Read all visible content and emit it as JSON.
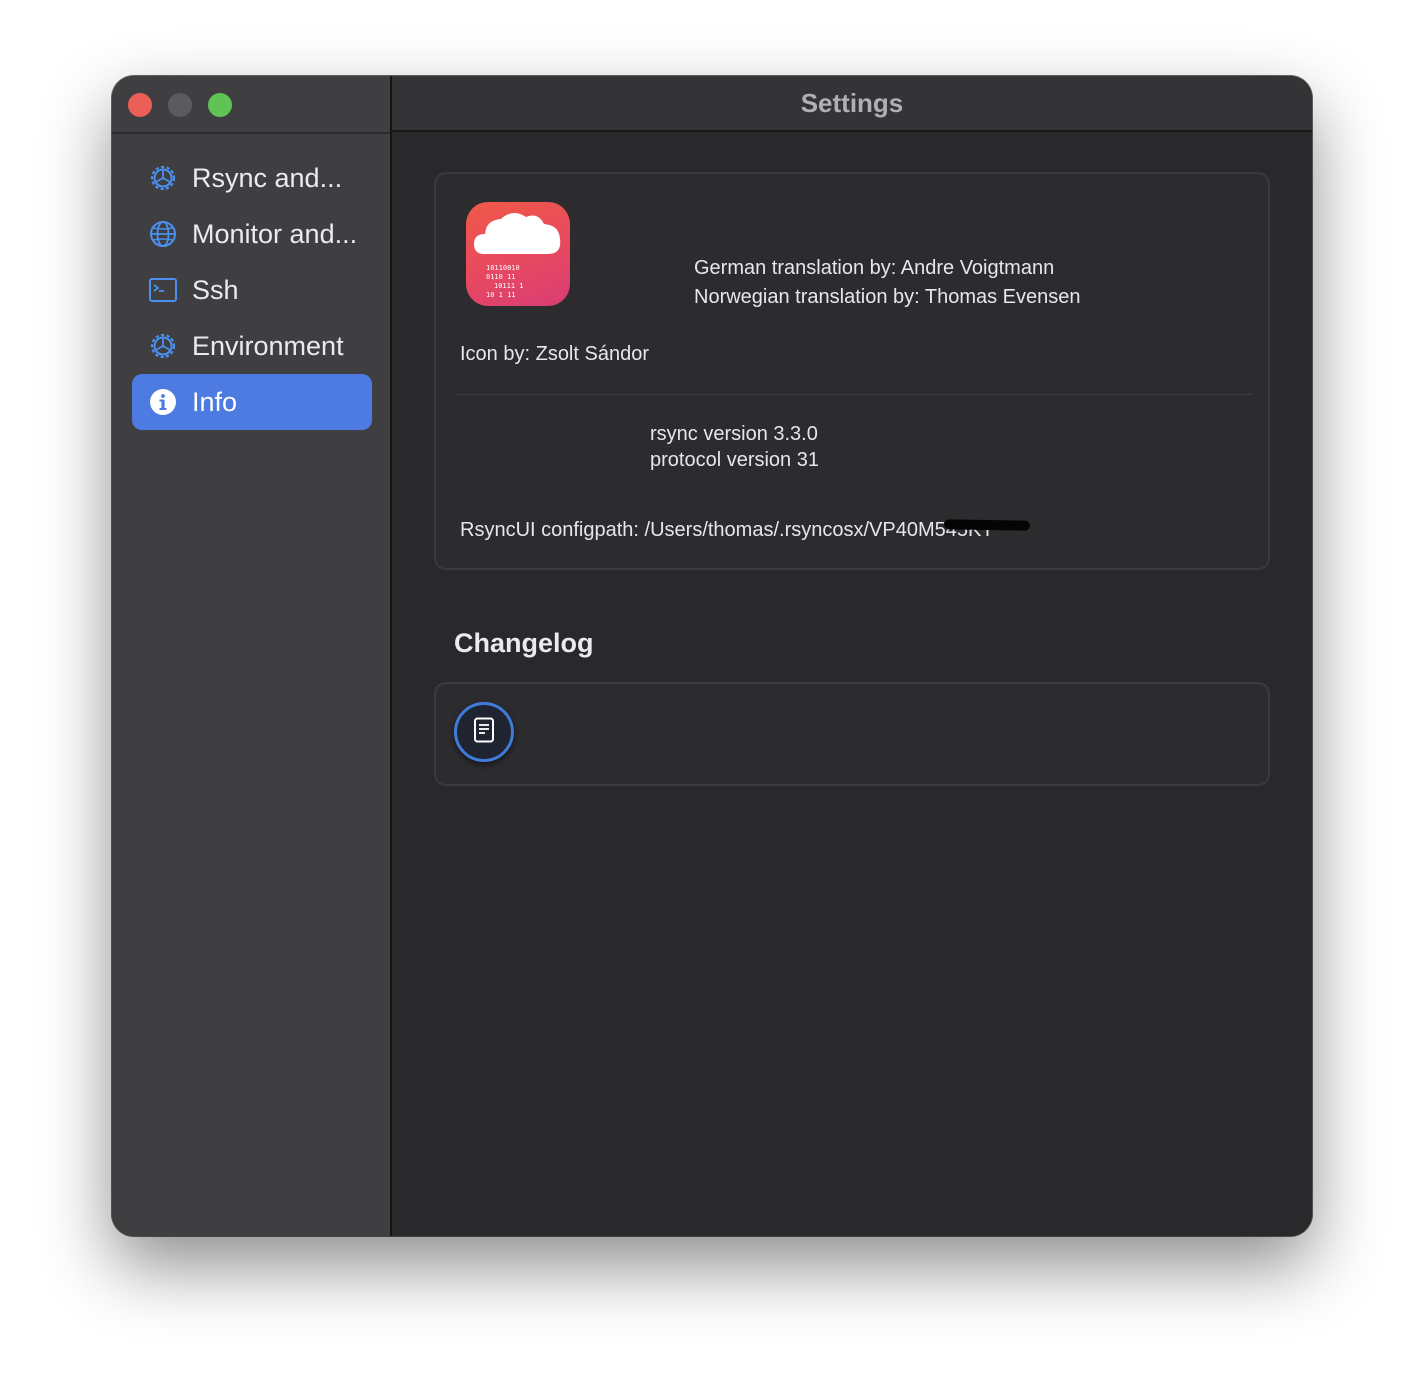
{
  "window": {
    "title": "Settings"
  },
  "sidebar": {
    "items": [
      {
        "label": "Rsync and...",
        "icon": "gear-icon",
        "selected": false
      },
      {
        "label": "Monitor and...",
        "icon": "globe-icon",
        "selected": false
      },
      {
        "label": "Ssh",
        "icon": "terminal-icon",
        "selected": false
      },
      {
        "label": "Environment",
        "icon": "gear-icon",
        "selected": false
      },
      {
        "label": "Info",
        "icon": "info-icon",
        "selected": true
      }
    ]
  },
  "info": {
    "credits": [
      "German translation by: Andre Voigtmann",
      "Norwegian translation by: Thomas Evensen"
    ],
    "icon_credit": "Icon by: Zsolt Sándor",
    "rsync_version": "rsync  version 3.3.0",
    "protocol_version": "protocol version 31",
    "configpath": "RsyncUI configpath: /Users/thomas/.rsyncosx/VP40M545KT"
  },
  "changelog": {
    "heading": "Changelog",
    "button_icon": "document-icon"
  },
  "colors": {
    "accent": "#4d7be1",
    "close": "#ec5f56",
    "minimize": "#5b5a5d",
    "maximize": "#5fc453",
    "sidebar_icon": "#4a90f0"
  }
}
